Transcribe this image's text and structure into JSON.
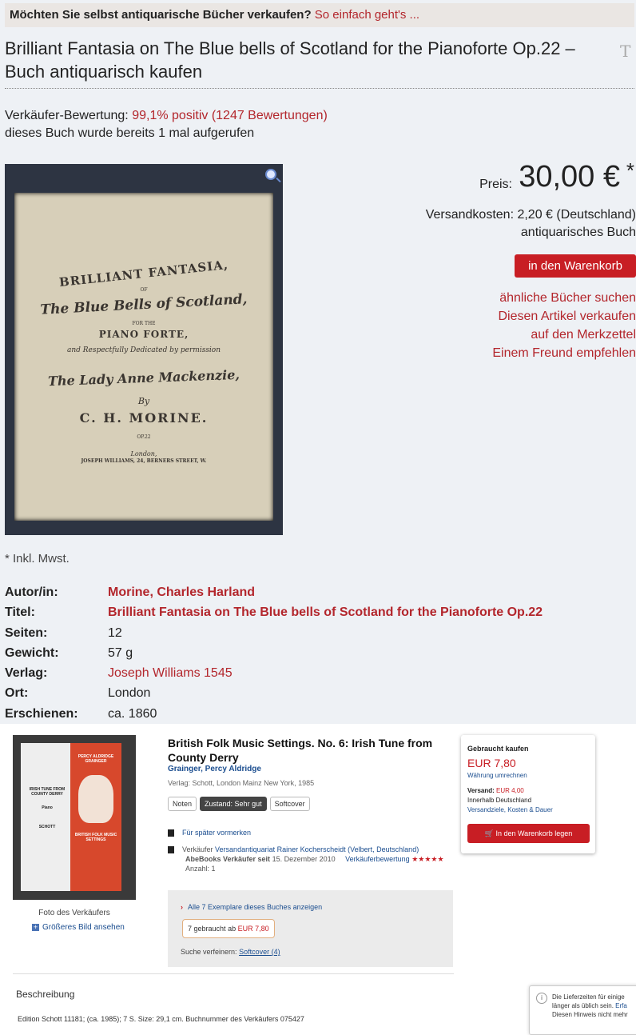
{
  "promo": {
    "question": "Möchten Sie selbst antiquarische Bücher verkaufen?",
    "link": "So einfach geht's ..."
  },
  "page_title": "Brilliant Fantasia on The Blue bells of Scotland for the Pianoforte Op.22 – Buch antiquarisch kaufen",
  "rating": {
    "label": "Verkäufer-Bewertung:",
    "value": "99,1% positiv (1247 Bewertungen)",
    "views": "dieses Buch wurde bereits 1 mal aufgerufen"
  },
  "cover": {
    "line1": "BRILLIANT FANTASIA,",
    "line2": "OF",
    "line3": "The Blue Bells of Scotland,",
    "line4": "FOR THE",
    "line5": "PIANO FORTE,",
    "line6": "and Respectfully Dedicated by permission",
    "line7": "The Lady Anne Mackenzie,",
    "line8": "By",
    "line9": "C. H. MORINE.",
    "line10": "OP.22",
    "line11": "London,",
    "line12": "JOSEPH WILLIAMS, 24, BERNERS STREET, W."
  },
  "price": {
    "label": "Preis:",
    "value": "30,00 €",
    "asterisk": "*"
  },
  "shipping": {
    "line1": "Versandkosten: 2,20 € (Deutschland)",
    "line2": "antiquarisches Buch"
  },
  "cart_button": "in den Warenkorb",
  "links": [
    "ähnliche Bücher suchen",
    "Diesen Artikel verkaufen",
    "auf den Merkzettel",
    "Einem Freund empfehlen"
  ],
  "mwst": "* Inkl. Mwst.",
  "details": [
    {
      "k": "Autor/in:",
      "v": "Morine, Charles Harland"
    },
    {
      "k": "Titel:",
      "v": "Brilliant Fantasia on The Blue bells of Scotland for the Pianoforte Op.22"
    },
    {
      "k": "Seiten:",
      "v": "12"
    },
    {
      "k": "Gewicht:",
      "v": "57 g"
    },
    {
      "k": "Verlag:",
      "v": "Joseph Williams 1545"
    },
    {
      "k": "Ort:",
      "v": "London"
    },
    {
      "k": "Erschienen:",
      "v": "ca. 1860"
    }
  ],
  "abe": {
    "cover_text": {
      "a": "IRISH TUNE FROM COUNTY DERRY",
      "b": "Piano",
      "c": "SCHOTT",
      "d": "PERCY ALDRIDGE GRAINGER",
      "e": "BRITISH FOLK MUSIC SETTINGS"
    },
    "caption": "Foto des Verkäufers",
    "bigger": "Größeres Bild ansehen",
    "title": "British Folk Music Settings. No. 6: Irish Tune from County Derry",
    "author": "Grainger, Percy Aldridge",
    "publisher": "Verlag: Schott, London Mainz New York, 1985",
    "tags": [
      "Noten",
      "Zustand: Sehr gut",
      "Softcover"
    ],
    "bookmark": "Für später vormerken",
    "seller_label": "Verkäufer",
    "seller": "Versandantiquariat Rainer Kocherscheidt (Velbert, Deutschland)",
    "since_label": "AbeBooks Verkäufer seit",
    "since": "15. Dezember 2010",
    "seller_rating": "Verkäuferbewertung",
    "stars": "★★★★★",
    "qty": "Anzahl: 1",
    "all_copies_arrow": "›",
    "all_copies": "Alle 7 Exemplare dieses Buches anzeigen",
    "used_pill": "7 gebraucht",
    "used_from": "ab",
    "used_price": "EUR 7,80",
    "refine_label": "Suche verfeinern:",
    "refine_link": "Softcover (4)",
    "buy_heading": "Gebraucht kaufen",
    "buy_price": "EUR 7,80",
    "convert": "Währung umrechnen",
    "ship_label": "Versand:",
    "ship_price": "EUR 4,00",
    "ship_within": "Innerhalb Deutschland",
    "ship_link": "Versandziele, Kosten & Dauer",
    "buy_button": "In den Warenkorb legen",
    "description_heading": "Beschreibung",
    "edition": "Edition Schott 11181; (ca. 1985); 7 S. Size: 29,1 cm. Buchnummer des Verkäufers 075427"
  },
  "toast": {
    "line1a": "Die Lieferzeiten für einige",
    "line2a": "länger als üblich sein.",
    "line2b": "Erfa",
    "line3": "Diesen Hinweis nicht mehr"
  }
}
